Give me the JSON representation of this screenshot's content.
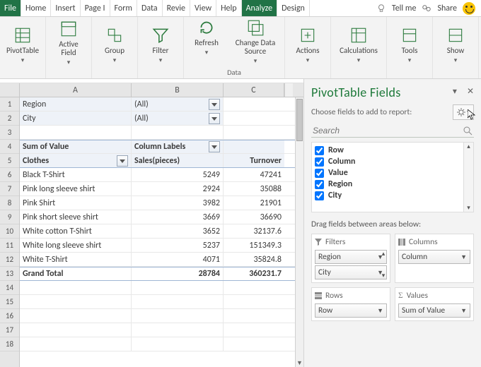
{
  "tabs": {
    "file": "File",
    "home": "Home",
    "insert": "Insert",
    "page": "Page I",
    "formulas": "Form",
    "data": "Data",
    "review": "Revie",
    "view": "View",
    "help": "Help",
    "analyze": "Analyze",
    "design": "Design",
    "tellme": "Tell me",
    "share": "Share"
  },
  "ribbon": {
    "pivottable": "PivotTable",
    "activefield": "Active\nField",
    "group": "Group",
    "filter": "Filter",
    "refresh": "Refresh",
    "changeds": "Change Data\nSource",
    "actions": "Actions",
    "calculations": "Calculations",
    "tools": "Tools",
    "show": "Show",
    "group_data": "Data"
  },
  "grid": {
    "colA": "A",
    "colB": "B",
    "colC": "C",
    "rownums": [
      "1",
      "2",
      "3",
      "4",
      "5",
      "6",
      "7",
      "8",
      "9",
      "10",
      "11",
      "12",
      "13",
      "14",
      "15",
      "16",
      "17",
      "18"
    ],
    "region_lbl": "Region",
    "region_val": "(All)",
    "city_lbl": "City",
    "city_val": "(All)",
    "sum_lbl": "Sum of Value",
    "collabels": "Column Labels",
    "clothes": "Clothes",
    "sales": "Sales(pieces)",
    "turnover": "Turnover",
    "rows": [
      {
        "name": "Black T-Shirt",
        "sales": "5249",
        "turn": "47241"
      },
      {
        "name": "Pink long sleeve shirt",
        "sales": "2924",
        "turn": "35088"
      },
      {
        "name": "Pink Shirt",
        "sales": "3982",
        "turn": "21901"
      },
      {
        "name": "Pink short sleeve shirt",
        "sales": "3669",
        "turn": "36690"
      },
      {
        "name": "White cotton T-Shirt",
        "sales": "3652",
        "turn": "32137.6"
      },
      {
        "name": "White long sleeve shirt",
        "sales": "5237",
        "turn": "151349.3"
      },
      {
        "name": "White T-Shirt",
        "sales": "4071",
        "turn": "35824.8"
      }
    ],
    "grand": "Grand Total",
    "gt_sales": "28784",
    "gt_turn": "360231.7"
  },
  "pane": {
    "title": "PivotTable Fields",
    "subtitle": "Choose fields to add to report:",
    "search_ph": "Search",
    "fields": [
      "Row",
      "Column",
      "Value",
      "Region",
      "City"
    ],
    "dragtext": "Drag fields between areas below:",
    "area_filters": "Filters",
    "area_columns": "Columns",
    "area_rows": "Rows",
    "area_values": "Values",
    "chip_region": "Region",
    "chip_city": "City",
    "chip_column": "Column",
    "chip_row": "Row",
    "chip_sum": "Sum of Value"
  }
}
